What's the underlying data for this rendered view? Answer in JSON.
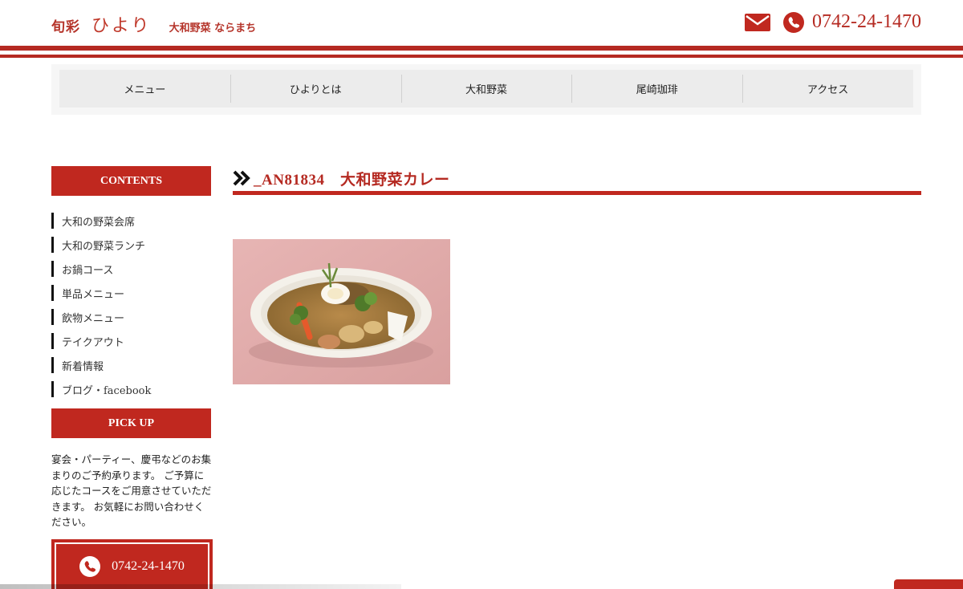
{
  "header": {
    "logo_jp": "旬彩",
    "logo_hiyori": "ひより",
    "logo_sub": "大和野菜 ならまち",
    "phone": "0742-24-1470",
    "icons": {
      "mail": "mail-icon",
      "phone": "phone-icon"
    }
  },
  "nav": {
    "items": [
      {
        "label": "メニュー"
      },
      {
        "label": "ひよりとは"
      },
      {
        "label": "大和野菜"
      },
      {
        "label": "尾崎珈琲"
      },
      {
        "label": "アクセス"
      }
    ]
  },
  "sidebar": {
    "contents_heading": "CONTENTS",
    "items": [
      {
        "label": "大和の野菜会席"
      },
      {
        "label": "大和の野菜ランチ"
      },
      {
        "label": "お鍋コース"
      },
      {
        "label": "単品メニュー"
      },
      {
        "label": "飲物メニュー"
      },
      {
        "label": "テイクアウト"
      },
      {
        "label": "新着情報"
      },
      {
        "label": "ブログ・facebook"
      }
    ],
    "pickup_heading": "PICK UP",
    "pickup_text": "宴会・パーティー、慶弔などのお集まりのご予約承ります。 ご予算に応じたコースをご用意させていただきます。 お気軽にお問い合わせください。",
    "tel_button": "0742-24-1470"
  },
  "main": {
    "title": "_AN81834　大和野菜カレー"
  },
  "colors": {
    "accent": "#c0281f",
    "title_red": "#b52a22",
    "nav_bg": "#ececec"
  }
}
